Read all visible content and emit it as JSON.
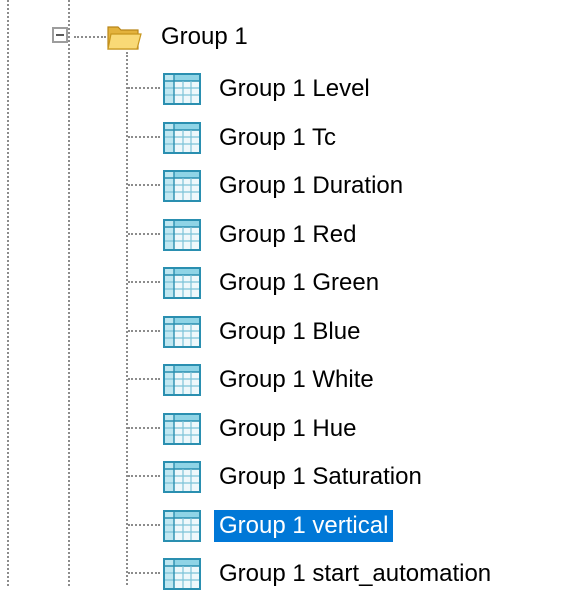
{
  "tree": {
    "group": {
      "label": "Group 1",
      "icon": "folder-open-icon",
      "expanded": true,
      "items": [
        {
          "label": "Group 1 Level",
          "icon": "table-icon",
          "selected": false
        },
        {
          "label": "Group 1 Tc",
          "icon": "table-icon",
          "selected": false
        },
        {
          "label": "Group 1 Duration",
          "icon": "table-icon",
          "selected": false
        },
        {
          "label": "Group 1 Red",
          "icon": "table-icon",
          "selected": false
        },
        {
          "label": "Group 1 Green",
          "icon": "table-icon",
          "selected": false
        },
        {
          "label": "Group 1 Blue",
          "icon": "table-icon",
          "selected": false
        },
        {
          "label": "Group 1 White",
          "icon": "table-icon",
          "selected": false
        },
        {
          "label": "Group 1 Hue",
          "icon": "table-icon",
          "selected": false
        },
        {
          "label": "Group 1 Saturation",
          "icon": "table-icon",
          "selected": false
        },
        {
          "label": "Group 1 vertical",
          "icon": "table-icon",
          "selected": true
        },
        {
          "label": "Group 1 start_automation",
          "icon": "table-icon",
          "selected": false
        }
      ]
    }
  },
  "colors": {
    "selection": "#0078d7",
    "selected_text": "#ffffff",
    "connector": "#8c8c8c"
  }
}
